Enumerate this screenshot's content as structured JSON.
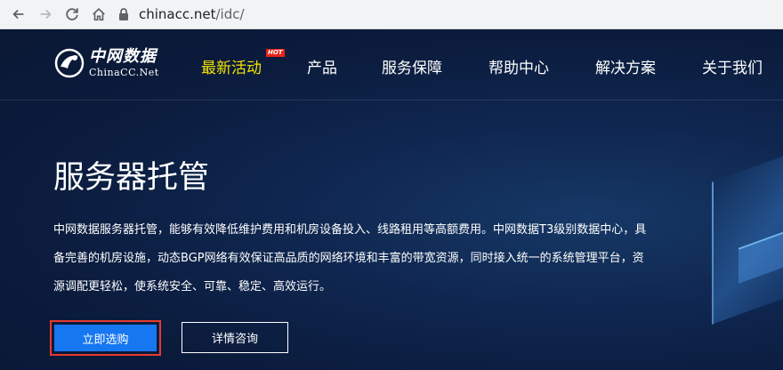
{
  "browser": {
    "url_host": "chinacc.net",
    "url_path": "/idc/"
  },
  "site": {
    "logo": {
      "cn": "中网数据",
      "en": "ChinaCC.Net"
    },
    "nav": [
      {
        "label": "最新活动",
        "badge": "HOT",
        "active": true
      },
      {
        "label": "产品"
      },
      {
        "label": "服务保障"
      },
      {
        "label": "帮助中心"
      },
      {
        "label": "解决方案"
      },
      {
        "label": "关于我们"
      }
    ]
  },
  "hero": {
    "title": "服务器托管",
    "desc_lines": [
      "中网数据服务器托管，能够有效降低维护费用和机房设备投入、线路租用等高额费用。中网数据T3级别数据中心，具",
      "备完善的机房设施，动态BGP网络有效保证高品质的网络环境和丰富的带宽资源，同时接入统一的系统管理平台，资",
      "源调配更轻松，使系统安全、可靠、稳定、高效运行。"
    ],
    "buy_label": "立即选购",
    "detail_label": "详情咨询"
  },
  "colors": {
    "accent_active": "#f3e200",
    "hot_badge": "#e8231a",
    "primary_button": "#1677f0",
    "highlight_border": "#e63b2e",
    "background": "#0b1b3c"
  }
}
